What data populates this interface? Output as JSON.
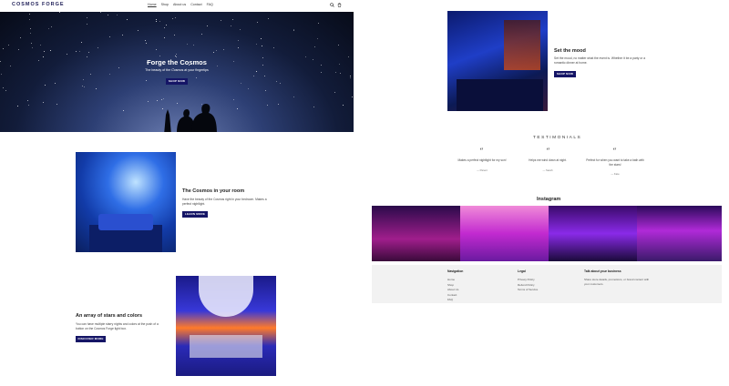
{
  "header": {
    "logo": "COSMOS FORGE",
    "nav": [
      "Home",
      "Shop",
      "About us",
      "Contact",
      "FAQ"
    ]
  },
  "hero": {
    "title": "Forge the Cosmos",
    "subtitle": "The beauty of the Cosmos at your fingertips",
    "button": "SHOP NOW"
  },
  "mood": {
    "title": "Set the mood",
    "body": "Set the mood, no matter what the event is. Whether it be a party or a romantic dinner at home.",
    "button": "SHOP NOW"
  },
  "cosmos_room": {
    "title": "The Cosmos in your room",
    "body": "Have the beauty of the Cosmos right in your bedroom. Makes a perfect nightlight.",
    "button": "LEARN MORE"
  },
  "array": {
    "title": "An array of stars and colors",
    "body": "You can have multiple starry nights and colors at the push of a button on the Cosmos Forge light box.",
    "button": "DISCOVER MORE"
  },
  "testimonials": {
    "title": "TESTIMONIALS",
    "items": [
      {
        "text": "Makes a perfect nightlight for my son!",
        "author": "— Parent"
      },
      {
        "text": "Helps me wind down at night.",
        "author": "— Sarah"
      },
      {
        "text": "Perfect for when you want to take a bath with the stars!",
        "author": "— Kate"
      }
    ]
  },
  "instagram": {
    "title": "Instagram"
  },
  "footer": {
    "nav_head": "Navigation",
    "nav_links": [
      "Home",
      "Shop",
      "About Us",
      "Contact",
      "FAQ"
    ],
    "legal_head": "Legal",
    "legal_links": [
      "Privacy Policy",
      "Refund Policy",
      "Terms of Service"
    ],
    "business_head": "Talk about your business",
    "business_body": "Share store details, promotions, or brand content with your customers."
  },
  "colors": {
    "accent": "#151566",
    "footer_bg": "#f2f2f2"
  }
}
